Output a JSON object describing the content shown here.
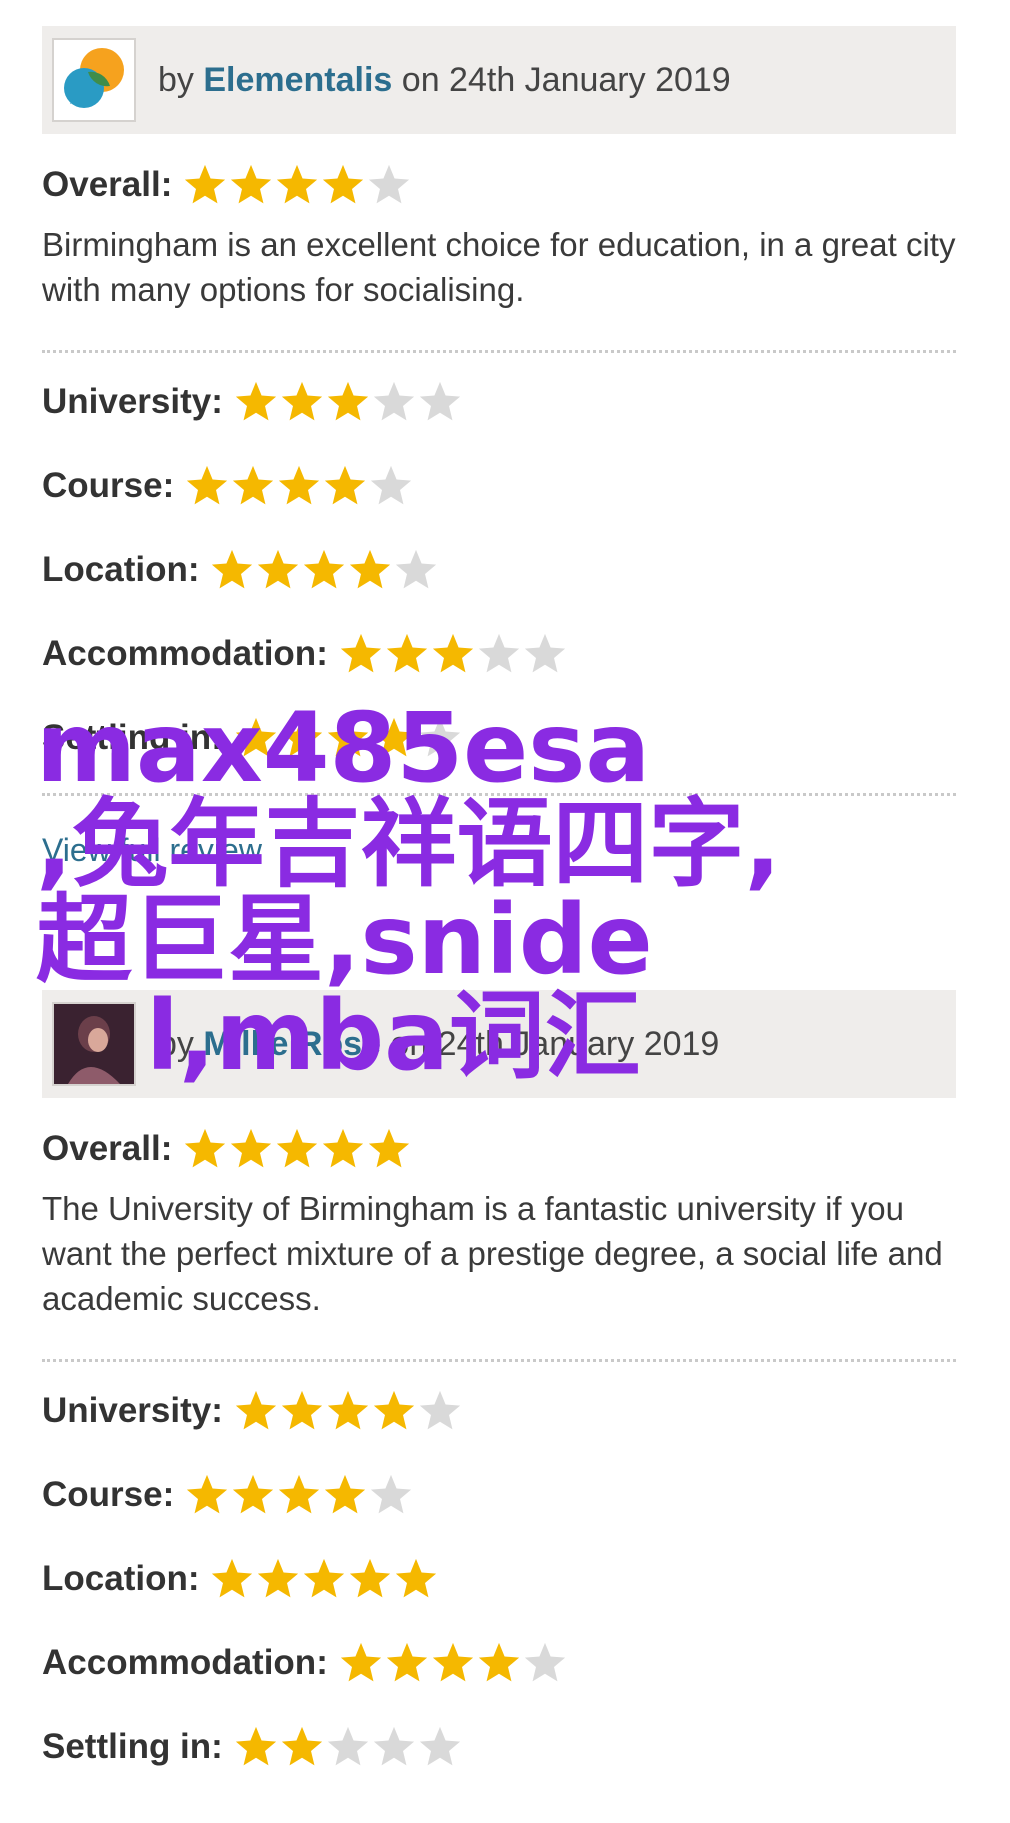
{
  "reviews": [
    {
      "by_prefix": "by ",
      "author": "Elementalis",
      "date_text": " on 24th January 2019",
      "avatar_icon": "speech-bubbles-logo",
      "overall_label": "Overall:",
      "overall_rating": 4,
      "text": "Birmingham is an excellent choice for education, in a great city with many options for socialising.",
      "ratings": [
        {
          "label": "University:",
          "value": 3
        },
        {
          "label": "Course:",
          "value": 4
        },
        {
          "label": "Location:",
          "value": 4
        },
        {
          "label": "Accommodation:",
          "value": 3
        },
        {
          "label": "Settling in:",
          "value": 4
        }
      ],
      "view_full_label": "View full review"
    },
    {
      "by_prefix": "by ",
      "author": "Millie Rose",
      "date_text": " on 24th January 2019",
      "avatar_icon": "user-photo",
      "overall_label": "Overall:",
      "overall_rating": 5,
      "text": "The University of Birmingham is a fantastic university if you want the perfect mixture of a prestige degree, a social life and academic success.",
      "ratings": [
        {
          "label": "University:",
          "value": 4
        },
        {
          "label": "Course:",
          "value": 4
        },
        {
          "label": "Location:",
          "value": 5
        },
        {
          "label": "Accommodation:",
          "value": 4
        },
        {
          "label": "Settling in:",
          "value": 2
        }
      ]
    }
  ],
  "max_stars": 5,
  "colors": {
    "star_filled": "#f5b800",
    "star_empty": "#d9d9d9",
    "link": "#2c6e8e",
    "watermark": "#8a2be2"
  },
  "watermark": {
    "line1": "max485esa",
    "line2": ",兔年吉祥语四字,",
    "line3": "超巨星,snide",
    "line4": "l,mba词汇"
  }
}
